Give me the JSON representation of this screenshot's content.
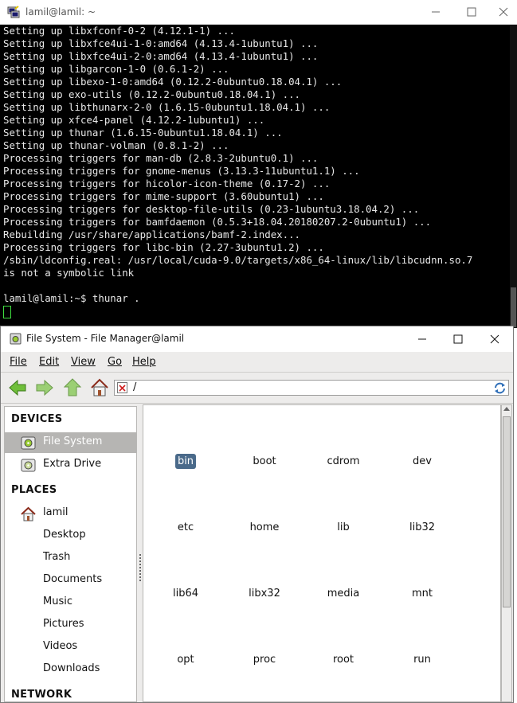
{
  "terminal": {
    "title": "lamil@lamil: ~",
    "lines": [
      "Setting up libxfconf-0-2 (4.12.1-1) ...",
      "Setting up libxfce4ui-1-0:amd64 (4.13.4-1ubuntu1) ...",
      "Setting up libxfce4ui-2-0:amd64 (4.13.4-1ubuntu1) ...",
      "Setting up libgarcon-1-0 (0.6.1-2) ...",
      "Setting up libexo-1-0:amd64 (0.12.2-0ubuntu0.18.04.1) ...",
      "Setting up exo-utils (0.12.2-0ubuntu0.18.04.1) ...",
      "Setting up libthunarx-2-0 (1.6.15-0ubuntu1.18.04.1) ...",
      "Setting up xfce4-panel (4.12.2-1ubuntu1) ...",
      "Setting up thunar (1.6.15-0ubuntu1.18.04.1) ...",
      "Setting up thunar-volman (0.8.1-2) ...",
      "Processing triggers for man-db (2.8.3-2ubuntu0.1) ...",
      "Processing triggers for gnome-menus (3.13.3-11ubuntu1.1) ...",
      "Processing triggers for hicolor-icon-theme (0.17-2) ...",
      "Processing triggers for mime-support (3.60ubuntu1) ...",
      "Processing triggers for desktop-file-utils (0.23-1ubuntu3.18.04.2) ...",
      "Processing triggers for bamfdaemon (0.5.3+18.04.20180207.2-0ubuntu1) ...",
      "Rebuilding /usr/share/applications/bamf-2.index...",
      "Processing triggers for libc-bin (2.27-3ubuntu1.2) ...",
      "/sbin/ldconfig.real: /usr/local/cuda-9.0/targets/x86_64-linux/lib/libcudnn.so.7",
      "is not a symbolic link",
      "",
      "lamil@lamil:~$ thunar ."
    ]
  },
  "file_manager": {
    "title": "File System - File Manager@lamil",
    "menu": [
      "File",
      "Edit",
      "View",
      "Go",
      "Help"
    ],
    "path": "/",
    "sidebar": {
      "devices_header": "DEVICES",
      "devices": [
        "File System",
        "Extra Drive"
      ],
      "places_header": "PLACES",
      "places": [
        "lamil",
        "Desktop",
        "Trash",
        "Documents",
        "Music",
        "Pictures",
        "Videos",
        "Downloads"
      ],
      "network_header": "NETWORK",
      "selected": "File System"
    },
    "files": [
      "bin",
      "boot",
      "cdrom",
      "dev",
      "etc",
      "home",
      "lib",
      "lib32",
      "lib64",
      "libx32",
      "media",
      "mnt",
      "opt",
      "proc",
      "root",
      "run"
    ],
    "selected_file": "bin"
  },
  "colors": {
    "terminal_bg": "#000000",
    "terminal_fg": "#e8e8e8",
    "cursor": "#3fdc3f",
    "selection": "#4a6a8a"
  }
}
